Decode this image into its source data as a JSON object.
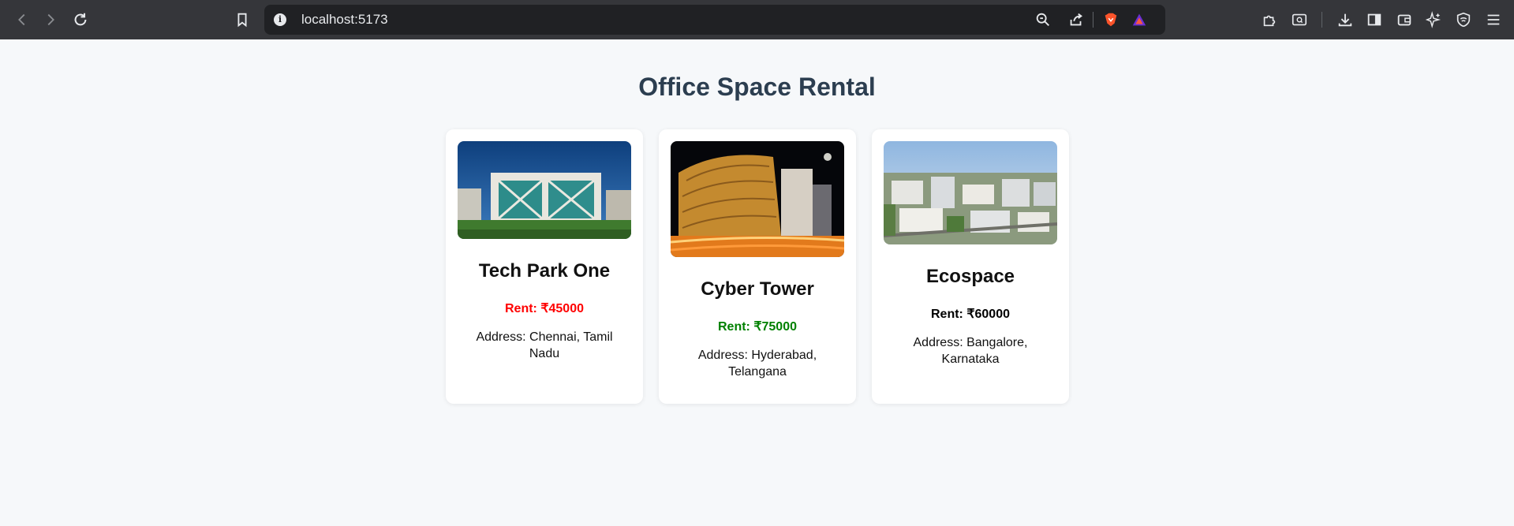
{
  "browser": {
    "url": "localhost:5173",
    "icons": [
      "back-icon",
      "forward-icon",
      "reload-icon",
      "bookmark-icon",
      "info-icon",
      "zoom-icon",
      "share-icon",
      "brave-shield-icon",
      "brave-rewards-icon",
      "extensions-icon",
      "reader-icon",
      "downloads-icon",
      "sidebar-icon",
      "wallet-icon",
      "leo-ai-icon",
      "vpn-icon",
      "menu-icon"
    ]
  },
  "page": {
    "title": "Office Space Rental"
  },
  "offices": [
    {
      "name": "Tech Park One",
      "rent": "Rent: ₹45000",
      "rent_color": "#ff0000",
      "address": "Address: Chennai, Tamil Nadu",
      "image": "tech-park-building-photo"
    },
    {
      "name": "Cyber Tower",
      "rent": "Rent: ₹75000",
      "rent_color": "#008000",
      "address": "Address: Hyderabad, Telangana",
      "image": "cyber-tower-night-photo"
    },
    {
      "name": "Ecospace",
      "rent": "Rent: ₹60000",
      "rent_color": "#000000",
      "address": "Address: Bangalore, Karnataka",
      "image": "ecospace-aerial-photo"
    }
  ]
}
